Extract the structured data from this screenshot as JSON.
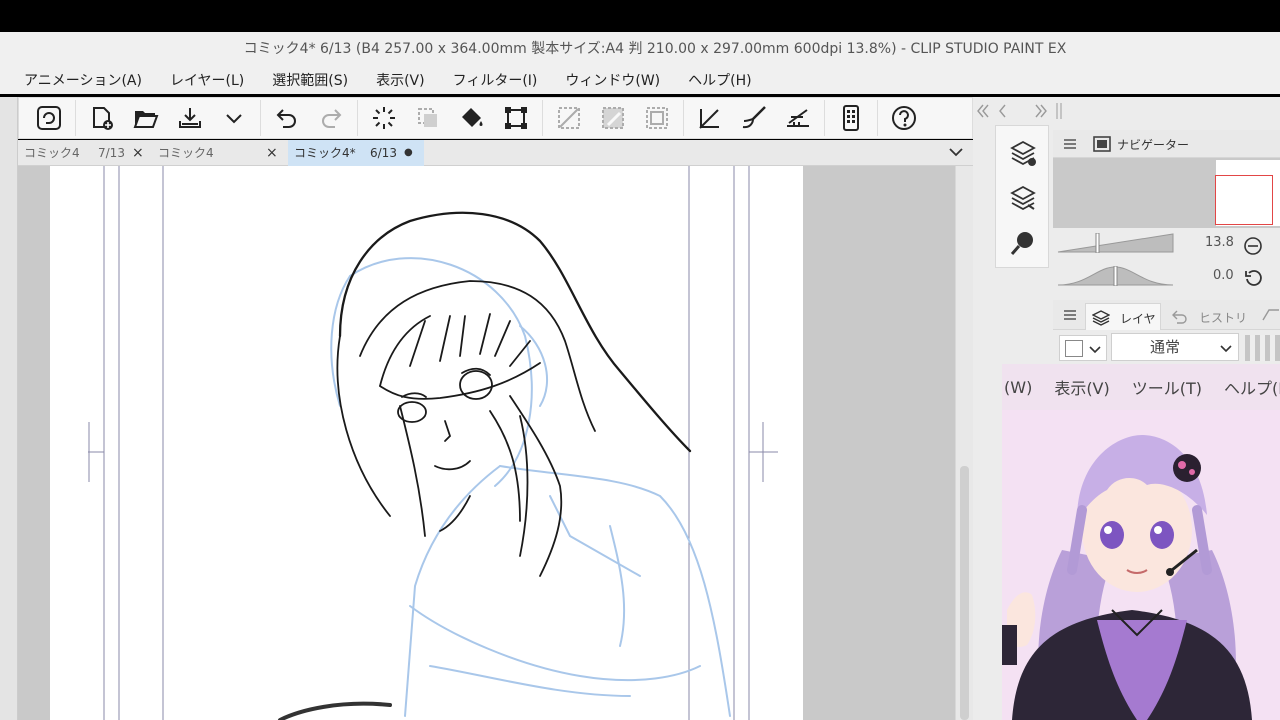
{
  "window": {
    "title": "コミック4* 6/13 (B4 257.00 x 364.00mm 製本サイズ:A4 判 210.00 x 297.00mm 600dpi 13.8%)  - CLIP STUDIO PAINT EX"
  },
  "menu": [
    "アニメーション(A)",
    "レイヤー(L)",
    "選択範囲(S)",
    "表示(V)",
    "フィルター(I)",
    "ウィンドウ(W)",
    "ヘルプ(H)"
  ],
  "toolbar": {
    "icons": [
      "clip-studio-icon",
      "new-file-icon",
      "open-file-icon",
      "save-icon",
      "save-dropdown-icon",
      "undo-icon",
      "redo-icon",
      "loading-icon",
      "selection-icon",
      "fill-icon",
      "transform-icon",
      "clear-icon",
      "clear-outside-icon",
      "deselect-icon",
      "ruler-pen-icon",
      "brush-icon",
      "perspective-ruler-icon",
      "smartphone-icon",
      "help-icon"
    ]
  },
  "tabs": [
    {
      "name": "コミック4",
      "page": "7/13",
      "close": "×"
    },
    {
      "name": "コミック4",
      "page": "",
      "close": "×"
    },
    {
      "name": "コミック4*",
      "page": "6/13",
      "close": "●"
    }
  ],
  "navigator": {
    "title": "ナビゲーター",
    "zoom": "13.8",
    "rotation": "0.0"
  },
  "layer_panel": {
    "tab_layer": "レイヤー",
    "tab_history": "ヒストリー",
    "blend_mode": "通常"
  },
  "overlay": {
    "menu": [
      "(W)",
      "表示(V)",
      "ツール(T)",
      "ヘルプ(H"
    ]
  },
  "colors": {
    "accent": "#cfe3f5",
    "nav_frame": "#e24646",
    "sketch_blue": "#a9c7ea"
  }
}
